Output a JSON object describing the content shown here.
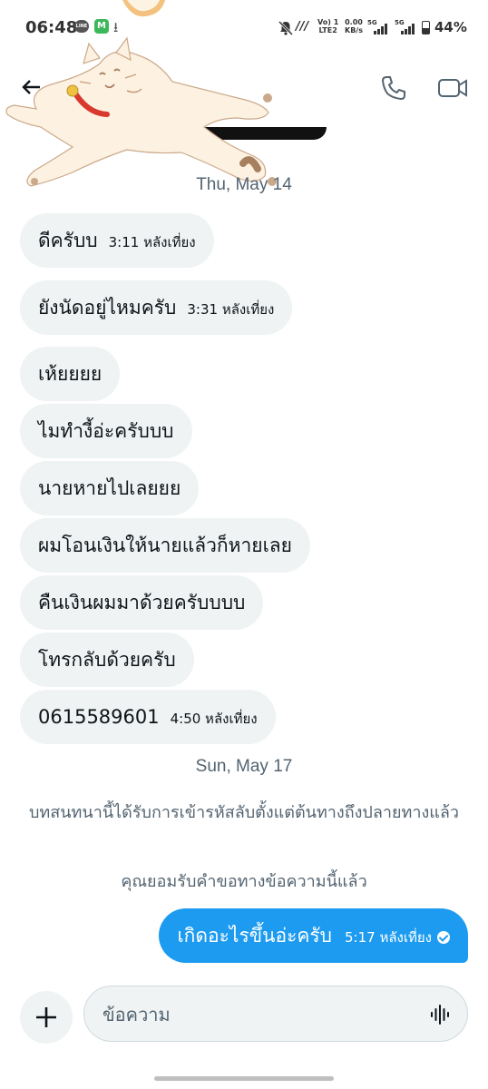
{
  "status_bar": {
    "time": "06:48",
    "line_label": "LINE",
    "m_label": "M",
    "volte_top": "Vo) 1",
    "volte_bottom": "LTE2",
    "speed_top": "0.00",
    "speed_bottom": "KB/s",
    "net1": "5G",
    "net2": "5G",
    "battery": "44%"
  },
  "conversation": {
    "date_1": "Thu, May 14",
    "date_2": "Sun, May 17",
    "received": [
      {
        "text": "ดีครับบ",
        "time": "3:11 หลังเที่ยง"
      },
      {
        "text": "ยังนัดอยู่ไหมครับ",
        "time": "3:31 หลังเที่ยง"
      },
      {
        "text": "เห้ยยยย",
        "time": ""
      },
      {
        "text": "ไมทำงี้อ่ะครับบบ",
        "time": ""
      },
      {
        "text": "นายหายไปเลยยย",
        "time": ""
      },
      {
        "text": "ผมโอนเงินให้นายแล้วก็หายเลย",
        "time": ""
      },
      {
        "text": "คืนเงินผมมาด้วยครับบบบ",
        "time": ""
      },
      {
        "text": "โทรกลับด้วยครับ",
        "time": ""
      },
      {
        "text": "0615589601",
        "time": "4:50 หลังเที่ยง"
      }
    ],
    "encryption_note": "บทสนทนานี้ได้รับการเข้ารหัสลับตั้งแต่ต้นทางถึงปลายทางแล้ว",
    "accept_note": "คุณยอมรับคำขอทางข้อความนี้แล้ว",
    "sent": {
      "text": "เกิดอะไรขึ้นอ่ะครับ",
      "time": "5:17 หลังเที่ยง"
    }
  },
  "composer": {
    "placeholder": "ข้อความ"
  },
  "colors": {
    "accent": "#1d9bf0",
    "bubble_received": "#eff3f4",
    "muted_text": "#536471"
  }
}
